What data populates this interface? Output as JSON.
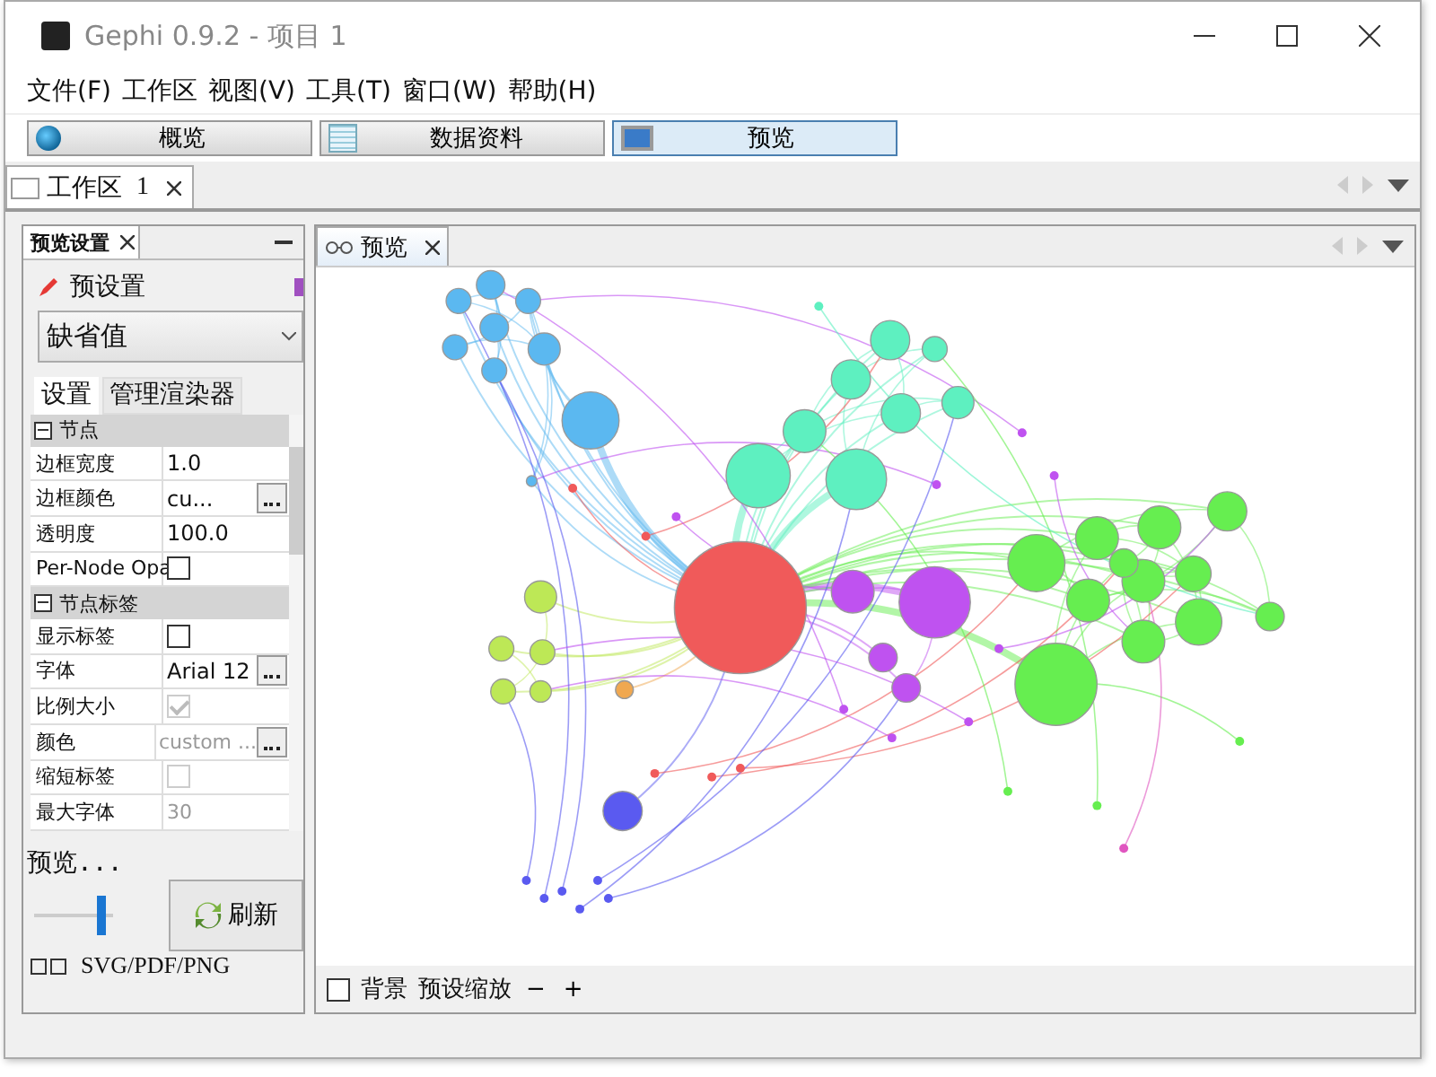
{
  "window": {
    "title": "Gephi 0.9.2 - 项目 1"
  },
  "menu": [
    "文件(F)",
    "工作区",
    "视图(V)",
    "工具(T)",
    "窗口(W)",
    "帮助(H)"
  ],
  "perspectives": [
    {
      "label": "概览",
      "kind": "globe",
      "selected": false
    },
    {
      "label": "数据资料",
      "kind": "table",
      "selected": false
    },
    {
      "label": "预览",
      "kind": "monitor",
      "selected": true
    }
  ],
  "workspace_tab": {
    "label": "工作区",
    "number": "1"
  },
  "settings_panel": {
    "title": "预览设置",
    "preset_label": "预设置",
    "preset_value": "缺省值",
    "tabs": [
      {
        "label": "设置",
        "selected": true
      },
      {
        "label": "管理渲染器",
        "selected": false
      }
    ],
    "groups": [
      {
        "title": "节点",
        "expanded": true,
        "rows": [
          {
            "name": "边框宽度",
            "kind": "text",
            "value": "1.0",
            "disabled": false
          },
          {
            "name": "边框颜色",
            "kind": "picker",
            "value": "cu...",
            "disabled": false
          },
          {
            "name": "透明度",
            "kind": "text",
            "value": "100.0",
            "disabled": false
          },
          {
            "name": "Per-Node Opa",
            "kind": "checkbox",
            "checked": false,
            "disabled": false
          }
        ]
      },
      {
        "title": "节点标签",
        "expanded": true,
        "rows": [
          {
            "name": "显示标签",
            "kind": "checkbox",
            "checked": false,
            "disabled": false
          },
          {
            "name": "字体",
            "kind": "picker",
            "value": "Arial 12",
            "disabled": false
          },
          {
            "name": "比例大小",
            "kind": "checkbox",
            "checked": true,
            "disabled": true
          },
          {
            "name": "颜色",
            "kind": "picker",
            "value": "custom ...",
            "disabled": true
          },
          {
            "name": "缩短标签",
            "kind": "checkbox",
            "checked": false,
            "disabled": true
          },
          {
            "name": "最大字体",
            "kind": "text",
            "value": "30",
            "disabled": true
          }
        ]
      }
    ],
    "preview_label": "预览...",
    "zoom_slider": {
      "level": 0.92
    },
    "refresh_button": "刷新",
    "export_label": "SVG/PDF/PNG"
  },
  "preview_panel": {
    "tab": "预览",
    "background_checkbox": {
      "label": "背景",
      "checked": false
    },
    "preset_zoom": "预设缩放",
    "zoom_out": "−",
    "zoom_in": "+"
  }
}
